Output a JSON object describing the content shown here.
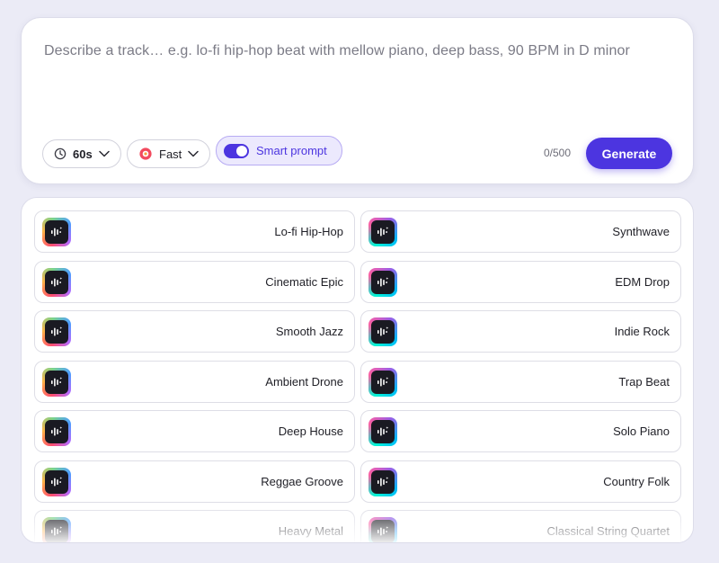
{
  "prompt": {
    "placeholder": "Describe a track… e.g. lo-fi hip-hop beat with mellow piano, deep bass, 90 BPM in D minor"
  },
  "controls": {
    "duration": "60s",
    "speed": "Fast",
    "smart_prompt_label": "Smart prompt",
    "smart_prompt_on": true,
    "char_count": "0/500",
    "generate_label": "Generate"
  },
  "colors": {
    "accent": "#4c35e0",
    "accent_soft": "#ece9fd",
    "background": "#ebebf6"
  },
  "presets": [
    {
      "name": "Lo-fi Hip-Hop",
      "icon": "waveform-icon"
    },
    {
      "name": "Synthwave",
      "icon": "waveform-icon"
    },
    {
      "name": "Cinematic Epic",
      "icon": "waveform-icon"
    },
    {
      "name": "EDM Drop",
      "icon": "waveform-icon"
    },
    {
      "name": "Smooth Jazz",
      "icon": "waveform-icon"
    },
    {
      "name": "Indie Rock",
      "icon": "waveform-icon"
    },
    {
      "name": "Ambient Drone",
      "icon": "waveform-icon"
    },
    {
      "name": "Trap Beat",
      "icon": "waveform-icon"
    },
    {
      "name": "Deep House",
      "icon": "waveform-icon"
    },
    {
      "name": "Solo Piano",
      "icon": "waveform-icon"
    },
    {
      "name": "Reggae Groove",
      "icon": "waveform-icon"
    },
    {
      "name": "Country Folk",
      "icon": "waveform-icon"
    },
    {
      "name": "Heavy Metal",
      "icon": "waveform-icon"
    },
    {
      "name": "Classical String Quartet",
      "icon": "waveform-icon"
    }
  ]
}
